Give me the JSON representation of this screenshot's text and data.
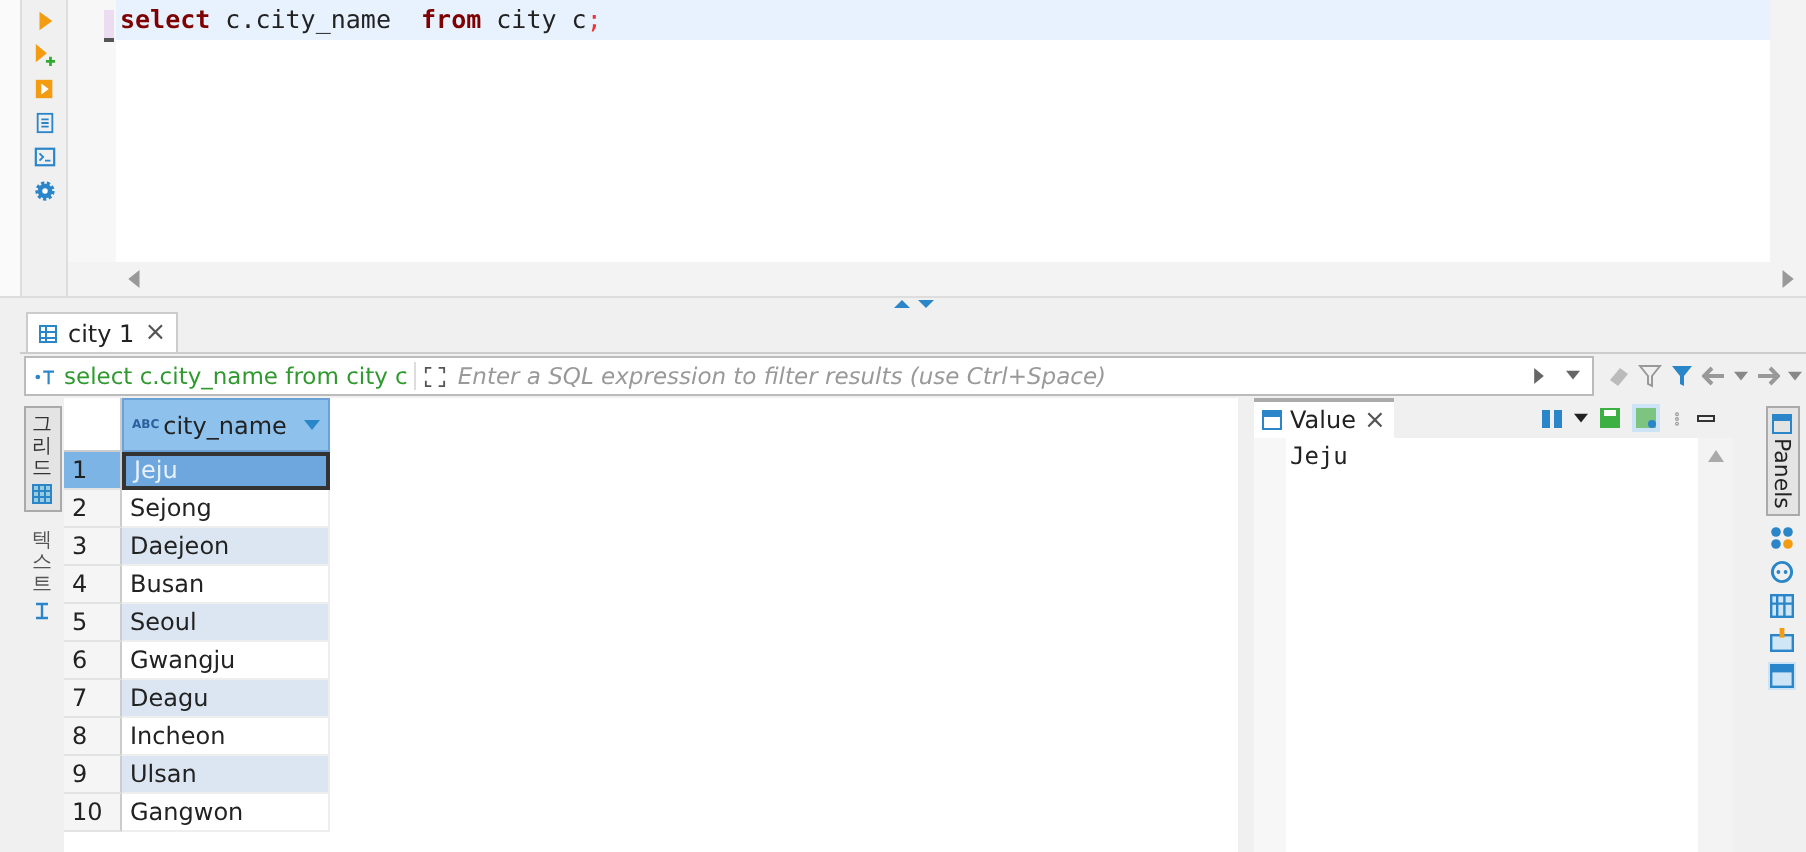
{
  "editor": {
    "sql": [
      {
        "kind": "keyword",
        "text": "select"
      },
      {
        "kind": "plain",
        "text": " c.city_name  "
      },
      {
        "kind": "keyword",
        "text": "from"
      },
      {
        "kind": "plain",
        "text": " city c"
      },
      {
        "kind": "punct",
        "text": ";"
      }
    ]
  },
  "result_tab": {
    "label": "city 1",
    "close": "×"
  },
  "filter": {
    "query": "select c.city_name from city c",
    "placeholder": "Enter a SQL expression to filter results (use Ctrl+Space)"
  },
  "view_tabs": [
    {
      "label": "그리드",
      "selected": true
    },
    {
      "label": "텍스트",
      "selected": false
    }
  ],
  "table": {
    "columns": [
      {
        "label": "city_name",
        "type_tag": "ABC"
      }
    ],
    "rows": [
      {
        "num": "1",
        "city_name": "Jeju",
        "selected": true
      },
      {
        "num": "2",
        "city_name": "Sejong",
        "selected": false
      },
      {
        "num": "3",
        "city_name": "Daejeon",
        "selected": false
      },
      {
        "num": "4",
        "city_name": "Busan",
        "selected": false
      },
      {
        "num": "5",
        "city_name": "Seoul",
        "selected": false
      },
      {
        "num": "6",
        "city_name": "Gwangju",
        "selected": false
      },
      {
        "num": "7",
        "city_name": "Deagu",
        "selected": false
      },
      {
        "num": "8",
        "city_name": "Incheon",
        "selected": false
      },
      {
        "num": "9",
        "city_name": "Ulsan",
        "selected": false
      },
      {
        "num": "10",
        "city_name": "Gangwon",
        "selected": false
      }
    ]
  },
  "value_panel": {
    "title": "Value",
    "close": "×",
    "value": "Jeju"
  },
  "side_panel": {
    "label": "Panels"
  }
}
